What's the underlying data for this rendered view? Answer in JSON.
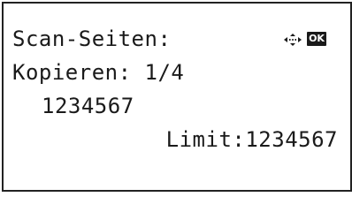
{
  "screen": {
    "header_label": "Scan-Seiten:",
    "copies_line": "Kopieren: 1/4",
    "page_count_value": "1234567",
    "limit_line": "Limit:1234567"
  },
  "icons": {
    "navigation": "four-way-arrow-icon",
    "ok": "ok-key-icon",
    "ok_label": "OK"
  },
  "colors": {
    "foreground": "#1a1a1a",
    "background": "#ffffff"
  }
}
